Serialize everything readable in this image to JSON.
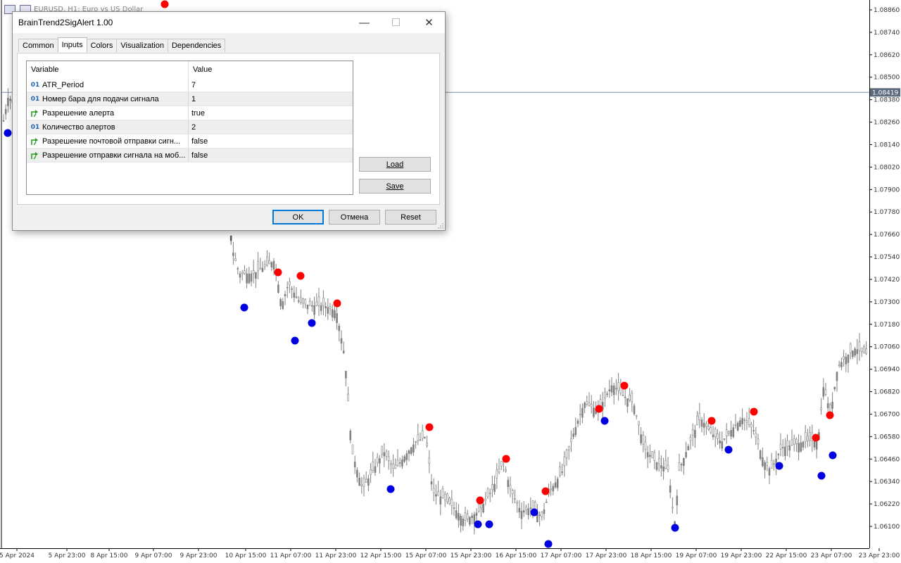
{
  "chart": {
    "title": "EURUSD, H1:  Euro vs US Dollar",
    "current_price": "1.08419",
    "price_axis": [
      "1.08860",
      "1.08740",
      "1.08620",
      "1.08500",
      "1.08380",
      "1.08260",
      "1.08140",
      "1.08020",
      "1.07900",
      "1.07780",
      "1.07660",
      "1.07540",
      "1.07420",
      "1.07300",
      "1.07180",
      "1.07060",
      "1.06940",
      "1.06820",
      "1.06700",
      "1.06580",
      "1.06460",
      "1.06340",
      "1.06220",
      "1.06100"
    ],
    "time_axis": [
      "5 Apr 2024",
      "5 Apr 23:00",
      "8 Apr 15:00",
      "9 Apr 07:00",
      "9 Apr 23:00",
      "10 Apr 15:00",
      "11 Apr 07:00",
      "11 Apr 23:00",
      "12 Apr 15:00",
      "15 Apr 07:00",
      "15 Apr 23:00",
      "16 Apr 15:00",
      "17 Apr 07:00",
      "17 Apr 23:00",
      "18 Apr 15:00",
      "19 Apr 07:00",
      "19 Apr 23:00",
      "22 Apr 15:00",
      "23 Apr 07:00",
      "23 Apr 23:00"
    ],
    "colors": {
      "sell_signal": "#ff0000",
      "buy_signal": "#0000e0",
      "candles": "#808080",
      "price_line": "#7a8fa6"
    }
  },
  "dialog": {
    "title": "BrainTrend2SigAlert 1.00",
    "controls": {
      "minimize": "—",
      "maximize": "☐",
      "close": "✕"
    },
    "tabs": [
      {
        "label": "Common",
        "active": false
      },
      {
        "label": "Inputs",
        "active": true
      },
      {
        "label": "Colors",
        "active": false
      },
      {
        "label": "Visualization",
        "active": false
      },
      {
        "label": "Dependencies",
        "active": false
      }
    ],
    "grid_headers": {
      "variable": "Variable",
      "value": "Value"
    },
    "params": [
      {
        "type": "int",
        "icon": "01",
        "name": "ATR_Period",
        "value": "7"
      },
      {
        "type": "int",
        "icon": "01",
        "name": "Номер бара для подачи сигнала",
        "value": "1"
      },
      {
        "type": "bool",
        "icon": "bool-arrow-icon",
        "name": "Разрешение алерта",
        "value": "true"
      },
      {
        "type": "int",
        "icon": "01",
        "name": "Количество алертов",
        "value": "2"
      },
      {
        "type": "bool",
        "icon": "bool-arrow-icon",
        "name": "Разрешение почтовой отправки сигн...",
        "value": "false"
      },
      {
        "type": "bool",
        "icon": "bool-arrow-icon",
        "name": "Разрешение отправки сигнала на моб...",
        "value": "false"
      }
    ],
    "buttons": {
      "load": "Load",
      "save": "Save",
      "ok": "OK",
      "cancel": "Отмена",
      "reset": "Reset"
    }
  }
}
